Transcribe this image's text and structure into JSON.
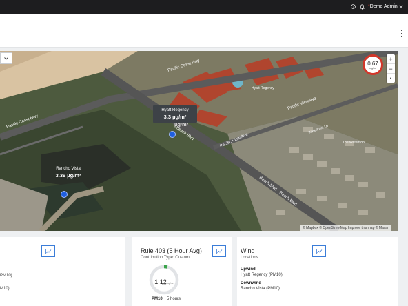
{
  "topbar": {
    "help_icon": "question-circle-icon",
    "notifications_icon": "bell-icon",
    "user_name": "Demo Admin",
    "user_dot": "*",
    "user_menu_icon": "chevron-down-icon"
  },
  "header": {
    "menu_icon": "kebab-vertical-icon"
  },
  "map": {
    "select_icon": "chevron-down-icon",
    "streets": [
      "Pacific Coast Hwy",
      "Pacific Coast Hwy",
      "Pacific View Ave",
      "Pacific View Ave",
      "Beach Blvd",
      "Beach Blvd",
      "Beach Blvd"
    ],
    "poi": [
      "Hyatt Regency",
      "Waterfront Ln",
      "The Waterfront"
    ],
    "locations": [
      {
        "name": "Hyatt Regency",
        "value": "3.3 µg/m³"
      },
      {
        "name": "Rancho Vista",
        "value": "3.39 µg/m³"
      }
    ],
    "ghost_label": {
      "name": "",
      "value": "µg/m³"
    },
    "badge": {
      "value": "0.67",
      "unit": "mg/m³"
    },
    "zoom": {
      "in": "+",
      "out": "−",
      "reset": "▴"
    },
    "attribution": "© Mapbox © OpenStreetMap Improve this map © Maxar"
  },
  "cards": {
    "left": {
      "line1": "PM10)",
      "line2": "M10)",
      "chart_icon": "line-chart-icon"
    },
    "rule": {
      "title": "Rule 403 (5 Hour Avg)",
      "subtitle": "Contribution Type: Custom",
      "gauge_value": "1.12",
      "gauge_unit": "mg/m³",
      "gauge_pct": "4%",
      "gauge_fraction": 0.04,
      "pollutant": "PM10",
      "window": "5 hours",
      "chart_icon": "line-chart-icon"
    },
    "wind": {
      "title": "Wind",
      "subtitle": "Locations",
      "upwind_label": "Upwind",
      "upwind_value": "Hyatt Regency (PM10)",
      "downwind_label": "Downwind",
      "downwind_value": "Rancho Vista (PM10)",
      "chart_icon": "line-chart-icon"
    }
  },
  "colors": {
    "accent": "#3b7dd8",
    "alert": "#d2372a",
    "gauge_ok": "#3aa34a",
    "topbar": "#1d1d1f"
  }
}
